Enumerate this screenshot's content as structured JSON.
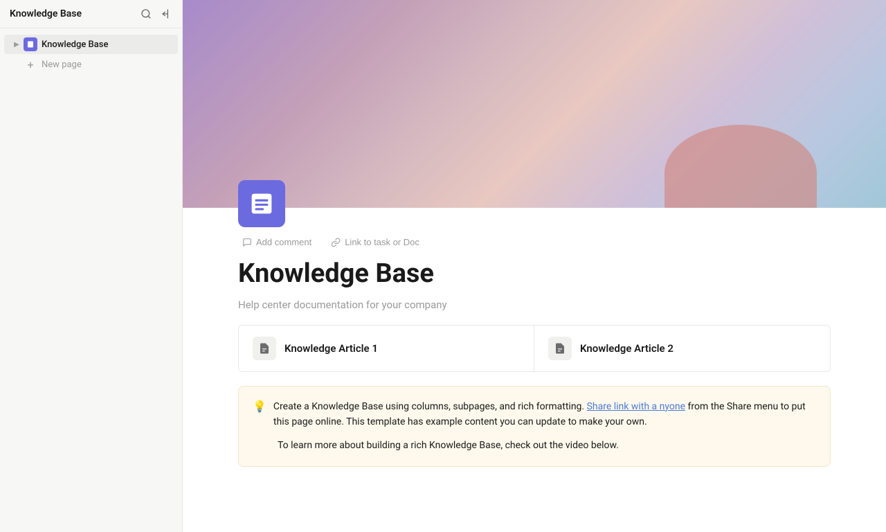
{
  "sidebar": {
    "title": "Knowledge Base",
    "search_tooltip": "Search",
    "collapse_tooltip": "Collapse sidebar",
    "nav_items": [
      {
        "id": "knowledge-base",
        "label": "Knowledge Base",
        "has_chevron": true,
        "active": true
      }
    ],
    "new_page_label": "New page"
  },
  "hero": {
    "alt": "Gradient hero banner"
  },
  "page": {
    "icon_alt": "Document icon",
    "actions": {
      "comment_label": "Add comment",
      "link_label": "Link to task or Doc"
    },
    "title": "Knowledge Base",
    "subtitle": "Help center documentation for your company"
  },
  "articles": [
    {
      "label": "Knowledge Article 1"
    },
    {
      "label": "Knowledge Article 2"
    }
  ],
  "info_box": {
    "icon": "💡",
    "paragraph1_pre": "Create a Knowledge Base using columns, subpages, and rich formatting. ",
    "paragraph1_link": "Share link with a nyone",
    "paragraph1_post": " from the Share menu to put this page online. This template has example content you can update to make your own.",
    "paragraph2": "To learn more about building a rich Knowledge Base, check out the video below."
  }
}
